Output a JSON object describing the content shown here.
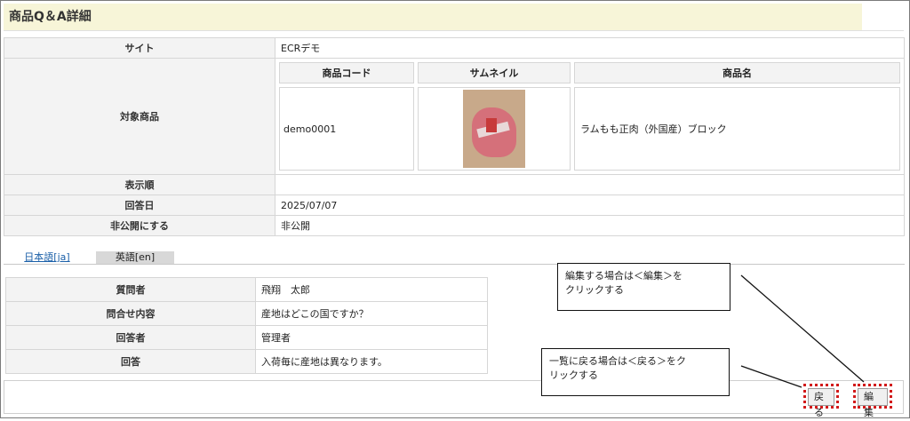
{
  "page": {
    "title": "商品Q＆A詳細"
  },
  "detail": {
    "site_label": "サイト",
    "site_value": "ECRデモ",
    "target_label": "対象商品",
    "product_headers": [
      "商品コード",
      "サムネイル",
      "商品名"
    ],
    "product_code": "demo0001",
    "product_name": "ラムもも正肉（外国産）ブロック",
    "order_label": "表示順",
    "order_value": "",
    "answer_date_label": "回答日",
    "answer_date_value": "2025/07/07",
    "private_label": "非公開にする",
    "private_value": "非公開"
  },
  "tabs": {
    "ja": "日本語[ja]",
    "en": "英語[en]"
  },
  "qa": {
    "questioner_label": "質問者",
    "questioner_value": "飛翔　太郎",
    "inquiry_label": "問合せ内容",
    "inquiry_value": "産地はどこの国ですか？",
    "answerer_label": "回答者",
    "answerer_value": "管理者",
    "answer_label": "回答",
    "answer_value": "入荷毎に産地は異なります。"
  },
  "buttons": {
    "back": "戻る",
    "edit": "編集"
  },
  "callouts": {
    "edit_line1": "編集する場合は＜編集＞を",
    "edit_line2": "クリックする",
    "back_line1": "一覧に戻る場合は＜戻る＞をク",
    "back_line2": "リックする"
  },
  "colors": {
    "title_bg": "#f7f5d8",
    "highlight": "#d21a1a",
    "link": "#1a5fa8"
  }
}
